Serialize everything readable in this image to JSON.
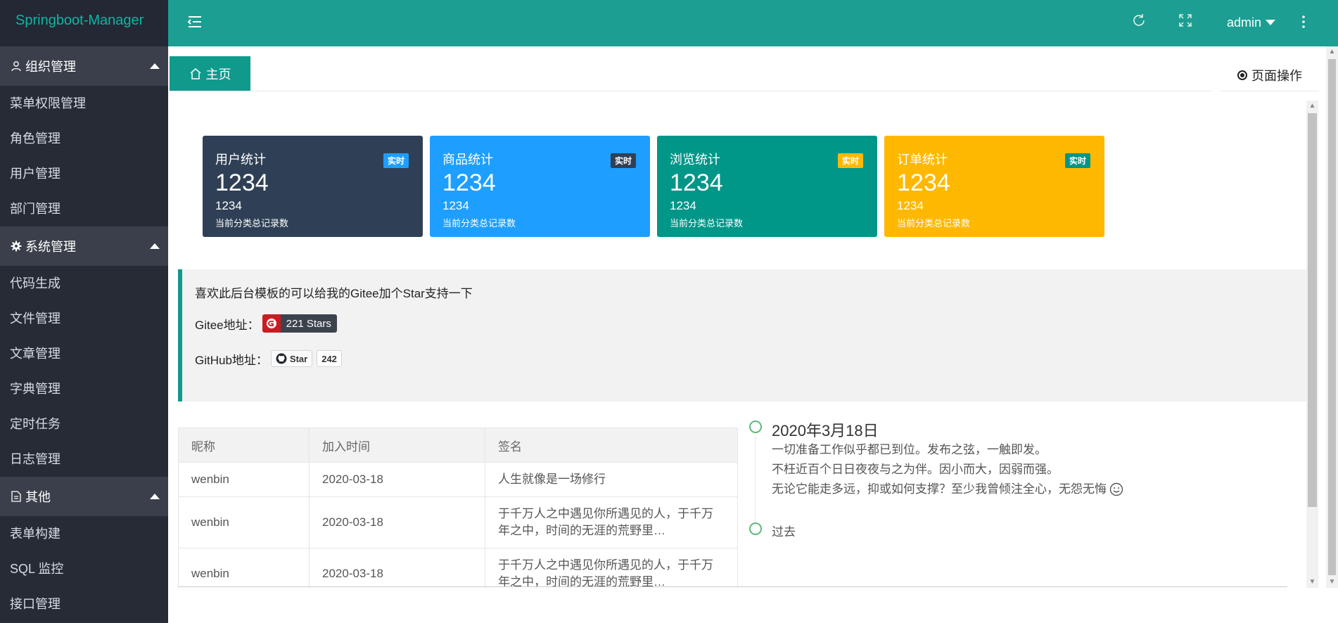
{
  "app": {
    "title": "Springboot-Manager"
  },
  "sidebar": {
    "groups": [
      {
        "label": "组织管理",
        "icon": "user-icon",
        "items": [
          "菜单权限管理",
          "角色管理",
          "用户管理",
          "部门管理"
        ]
      },
      {
        "label": "系统管理",
        "icon": "gear-icon",
        "items": [
          "代码生成",
          "文件管理",
          "文章管理",
          "字典管理",
          "定时任务",
          "日志管理"
        ]
      },
      {
        "label": "其他",
        "icon": "document-icon",
        "items": [
          "表单构建",
          "SQL 监控",
          "接口管理"
        ]
      }
    ]
  },
  "header": {
    "user": "admin",
    "icons": [
      "menu-toggle-icon",
      "refresh-icon",
      "fullscreen-icon",
      "more-vertical-icon"
    ]
  },
  "tabs": {
    "home": "主页",
    "page_ops": "页面操作"
  },
  "cards": [
    {
      "title": "用户统计",
      "badge": "实时",
      "value": "1234",
      "sub": "1234",
      "desc": "当前分类总记录数",
      "bg": "#2f4056",
      "badge_bg": "#1e9fff"
    },
    {
      "title": "商品统计",
      "badge": "实时",
      "value": "1234",
      "sub": "1234",
      "desc": "当前分类总记录数",
      "bg": "#1e9fff",
      "badge_bg": "#2f4056"
    },
    {
      "title": "浏览统计",
      "badge": "实时",
      "value": "1234",
      "sub": "1234",
      "desc": "当前分类总记录数",
      "bg": "#009688",
      "badge_bg": "#ffb800"
    },
    {
      "title": "订单统计",
      "badge": "实时",
      "value": "1234",
      "sub": "1234",
      "desc": "当前分类总记录数",
      "bg": "#ffb800",
      "badge_bg": "#009688"
    }
  ],
  "notice": {
    "text": "喜欢此后台模板的可以给我的Gitee加个Star支持一下",
    "gitee_label": "Gitee地址：",
    "gitee_badge": "221 Stars",
    "github_label": "GitHub地址：",
    "github_star": "Star",
    "github_count": "242"
  },
  "table": {
    "headers": [
      "昵称",
      "加入时间",
      "签名"
    ],
    "rows": [
      [
        "wenbin",
        "2020-03-18",
        "人生就像是一场修行"
      ],
      [
        "wenbin",
        "2020-03-18",
        "于千万人之中遇见你所遇见的人，于千万年之中，时间的无涯的荒野里…"
      ],
      [
        "wenbin",
        "2020-03-18",
        "于千万人之中遇见你所遇见的人，于千万年之中，时间的无涯的荒野里…"
      ]
    ]
  },
  "timeline": {
    "title": "2020年3月18日",
    "lines": [
      "一切准备工作似乎都已到位。发布之弦，一触即发。",
      "不枉近百个日日夜夜与之为伴。因小而大，因弱而强。",
      "无论它能走多远，抑或如何支撑？至少我曾倾注全心，无怨无悔"
    ],
    "past": "过去"
  }
}
